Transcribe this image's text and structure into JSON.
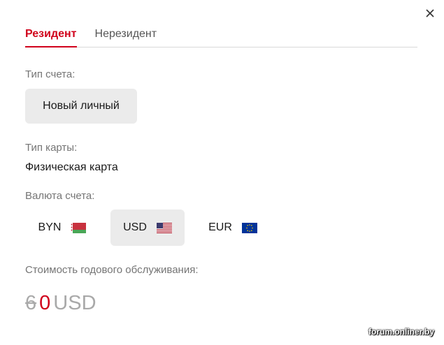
{
  "tabs": [
    {
      "label": "Резидент",
      "active": true
    },
    {
      "label": "Нерезидент",
      "active": false
    }
  ],
  "account_type": {
    "label": "Тип счета:",
    "value": "Новый личный"
  },
  "card_type": {
    "label": "Тип карты:",
    "value": "Физическая карта"
  },
  "currency": {
    "label": "Валюта счета:",
    "options": [
      {
        "code": "BYN",
        "icon": "belarus-flag-icon",
        "selected": false
      },
      {
        "code": "USD",
        "icon": "usa-flag-icon",
        "selected": true
      },
      {
        "code": "EUR",
        "icon": "eu-flag-icon",
        "selected": false
      }
    ]
  },
  "service": {
    "label": "Стоимость годового обслуживания:",
    "old_price": "6",
    "new_price": "0",
    "currency": "USD"
  },
  "watermark": "forum.onliner.by",
  "colors": {
    "accent": "#d0021b",
    "muted": "#a9a9a9",
    "selected_bg": "#ebebeb"
  }
}
